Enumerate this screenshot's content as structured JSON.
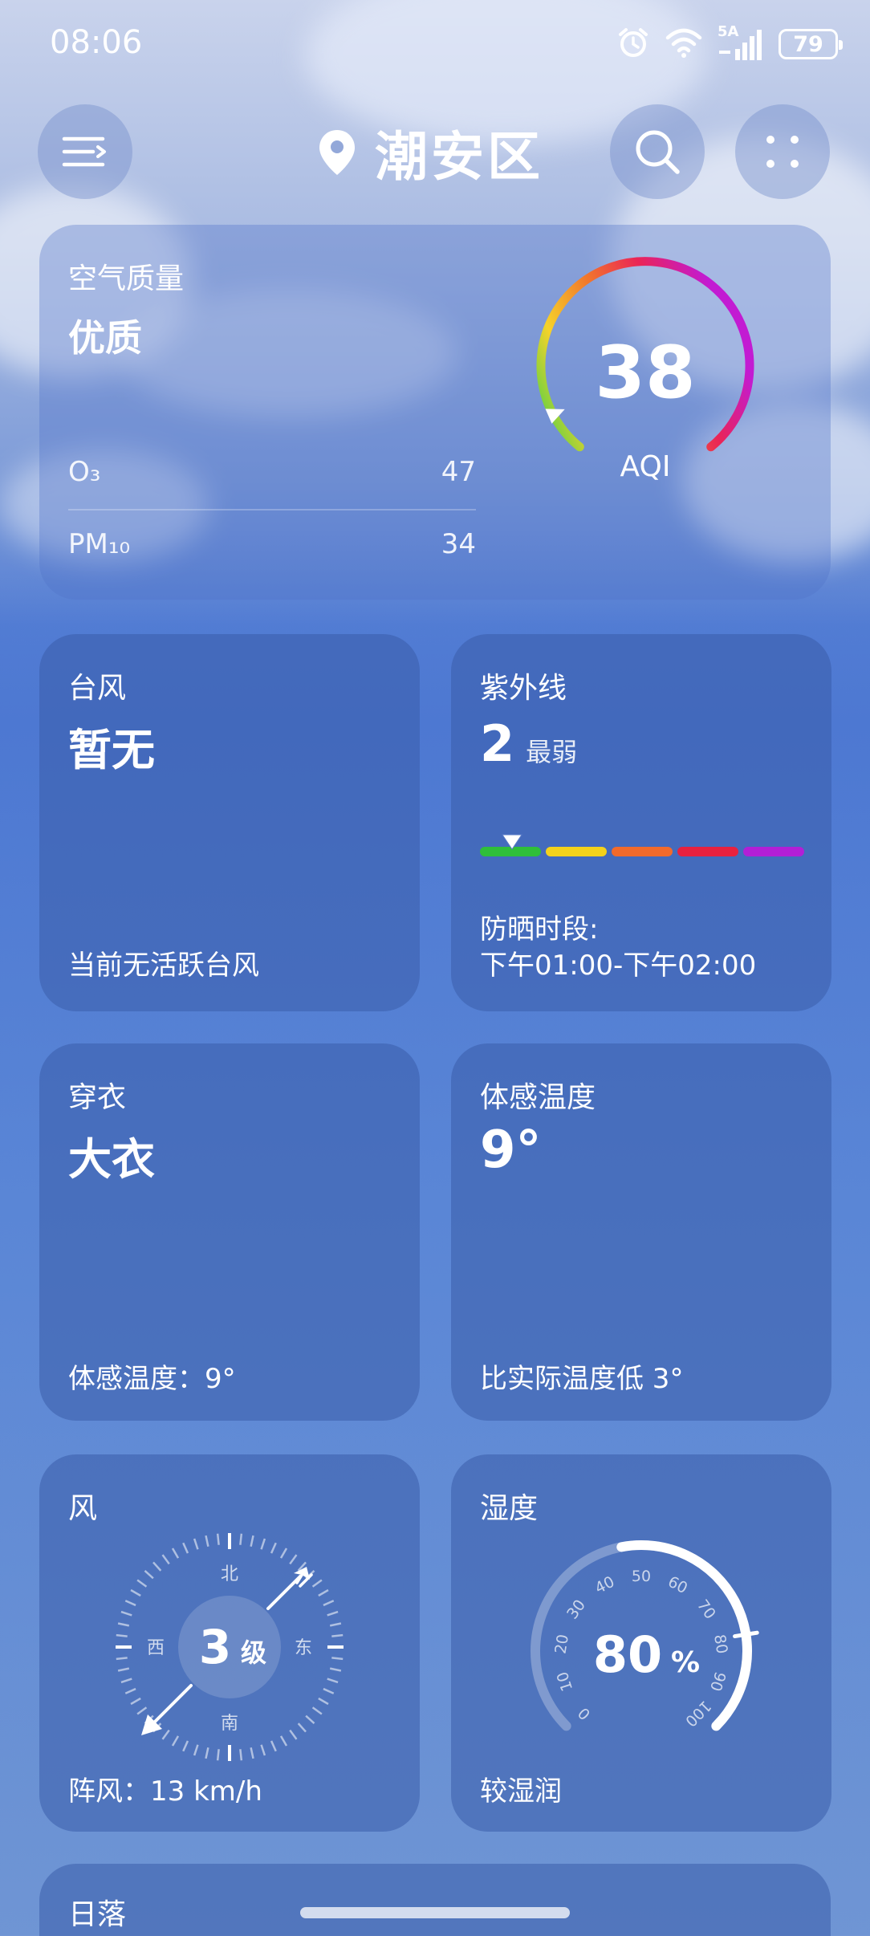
{
  "status_bar": {
    "time": "08:06",
    "network": "5A",
    "battery": "79"
  },
  "header": {
    "location": "潮安区"
  },
  "air_quality": {
    "title": "空气质量",
    "level": "优质",
    "aqi": "38",
    "aqi_unit": "AQI",
    "aqi_fraction": 0.08,
    "pollutants": [
      {
        "name": "O₃",
        "value": "47"
      },
      {
        "name": "PM₁₀",
        "value": "34"
      }
    ]
  },
  "typhoon": {
    "title": "台风",
    "value": "暂无",
    "note": "当前无活跃台风"
  },
  "uv": {
    "title": "紫外线",
    "index": "2",
    "level": "最弱",
    "index_fraction": 0.1,
    "sun_label": "防晒时段:",
    "sun_time": "下午01:00-下午02:00",
    "scale_colors": [
      "#2fbf3a",
      "#f4d21b",
      "#f26a2b",
      "#e8213f",
      "#b21fd6"
    ]
  },
  "clothing": {
    "title": "穿衣",
    "value": "大衣",
    "note": "体感温度：9°"
  },
  "feels_like": {
    "title": "体感温度",
    "value": "9°",
    "note": "比实际温度低 3°"
  },
  "wind": {
    "title": "风",
    "level_number": "3",
    "level_unit": "级",
    "directions": {
      "north": "北",
      "south": "南",
      "east": "东",
      "west": "西"
    },
    "gust": "阵风：13 km/h"
  },
  "humidity": {
    "title": "湿度",
    "value": "80",
    "unit": "%",
    "fraction": 0.8,
    "ticks": [
      "0",
      "10",
      "20",
      "30",
      "40",
      "50",
      "60",
      "70",
      "80",
      "90",
      "100"
    ],
    "note": "较湿润"
  },
  "sunset": {
    "title": "日落"
  }
}
